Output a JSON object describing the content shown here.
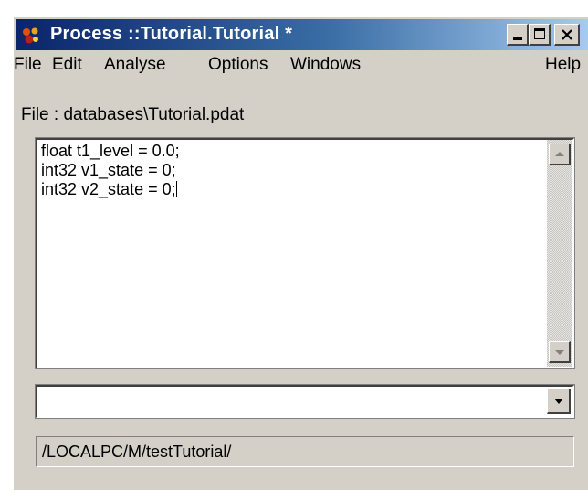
{
  "window": {
    "title": "Process ::Tutorial.Tutorial *",
    "icon": "process-app-icon",
    "controls": [
      "minimize-icon",
      "maximize-icon",
      "close-icon"
    ]
  },
  "menubar": {
    "file": "File",
    "edit": "Edit",
    "analyse": "Analyse",
    "options": "Options",
    "windows": "Windows",
    "help": "Help"
  },
  "file_label": "File : databases\\Tutorial.pdat",
  "editor": {
    "lines": [
      "float t1_level = 0.0;",
      "int32 v1_state = 0;",
      "int32 v2_state = 0;"
    ]
  },
  "combo": {
    "value": ""
  },
  "path_bar": {
    "text": "/LOCALPC/M/testTutorial/"
  },
  "colors": {
    "titlebar_start": "#0a246a",
    "titlebar_end": "#a6caf0",
    "face": "#d4d0c8"
  }
}
